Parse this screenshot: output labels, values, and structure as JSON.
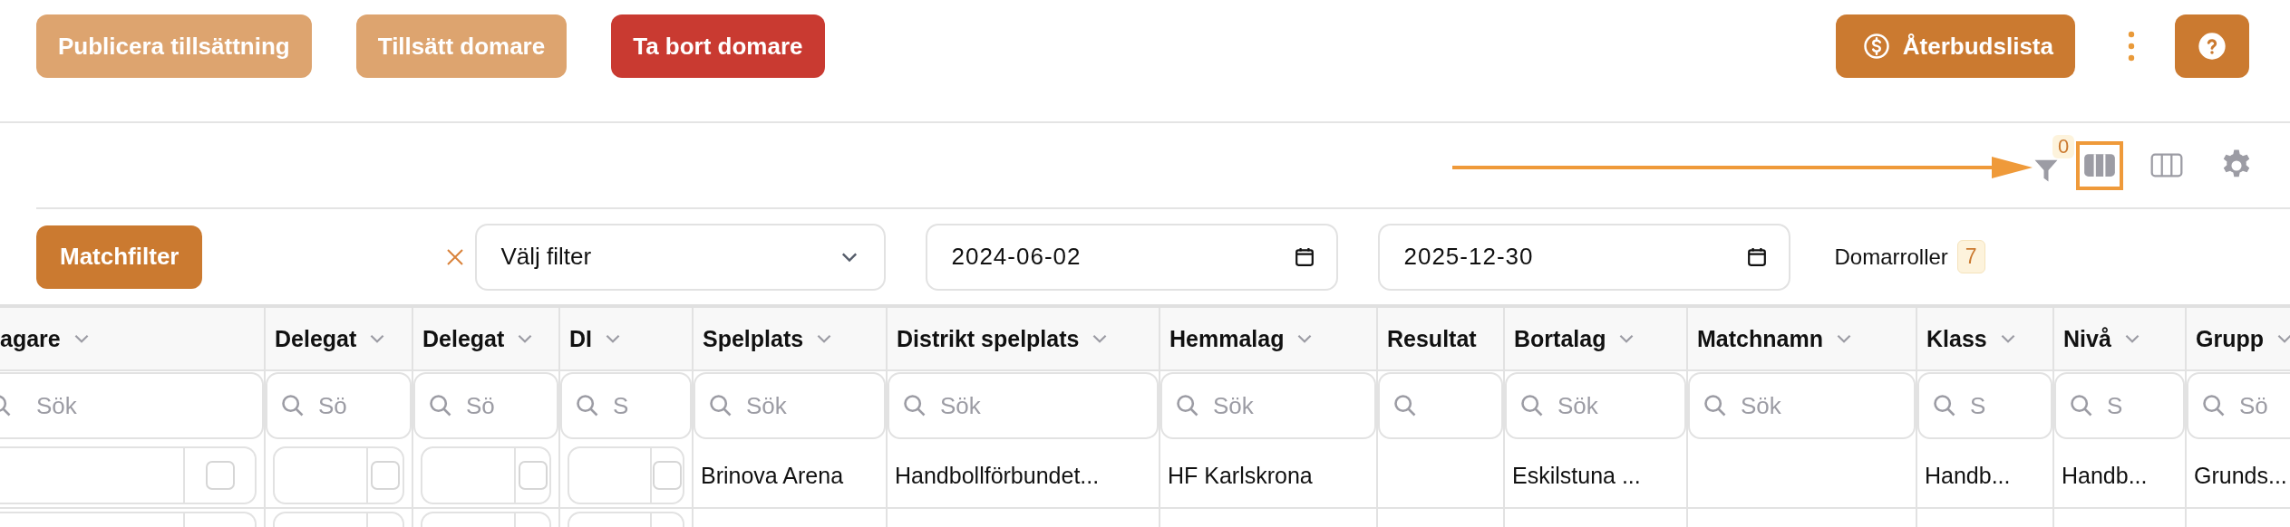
{
  "actions": {
    "buttons": [
      {
        "label": "Publicera tillsättning",
        "kind": "light"
      },
      {
        "label": "Tillsätt domare",
        "kind": "light"
      },
      {
        "label": "Ta bort domare",
        "kind": "danger"
      }
    ],
    "refund_button": {
      "label": "Återbudslista"
    }
  },
  "view_bar": {
    "filter_count": "0",
    "views": [
      {
        "selected": true
      },
      {
        "selected": false
      }
    ]
  },
  "filters": {
    "match_filter_button": "Matchfilter",
    "select": {
      "placeholder": "Välj filter"
    },
    "date_from": "2024-06-02",
    "date_to": "2025-12-30",
    "roles": {
      "label": "Domarroller",
      "count": "7"
    }
  },
  "table": {
    "columns": [
      {
        "title": "agare",
        "menu": true,
        "placeholder": "Sök",
        "kind": "check"
      },
      {
        "title": "Delegat",
        "menu": true,
        "placeholder": "Sö",
        "kind": "check"
      },
      {
        "title": "Delegat",
        "menu": true,
        "placeholder": "Sö",
        "kind": "check"
      },
      {
        "title": "DI",
        "menu": true,
        "placeholder": "S",
        "kind": "check"
      },
      {
        "title": "Spelplats",
        "menu": true,
        "placeholder": "Sök",
        "kind": "text"
      },
      {
        "title": "Distrikt spelplats",
        "menu": true,
        "placeholder": "Sök",
        "kind": "text"
      },
      {
        "title": "Hemmalag",
        "menu": true,
        "placeholder": "Sök",
        "kind": "text"
      },
      {
        "title": "Resultat",
        "menu": false,
        "kind": "text"
      },
      {
        "title": "Bortalag",
        "menu": true,
        "placeholder": "Sök",
        "kind": "text"
      },
      {
        "title": "Matchnamn",
        "menu": true,
        "placeholder": "Sök",
        "kind": "text"
      },
      {
        "title": "Klass",
        "menu": true,
        "placeholder": "S",
        "kind": "text"
      },
      {
        "title": "Nivå",
        "menu": true,
        "placeholder": "S",
        "kind": "text"
      },
      {
        "title": "Grupp",
        "menu": true,
        "placeholder": "Sö",
        "kind": "text"
      }
    ],
    "rows": [
      {
        "cells": [
          {
            "checked": false
          },
          {
            "checked": false
          },
          {
            "checked": false
          },
          {
            "checked": false
          },
          {
            "text": "Brinova Arena"
          },
          {
            "text": "Handbollförbundet..."
          },
          {
            "text": "HF Karlskrona"
          },
          {},
          {
            "text": "Eskilstuna ..."
          },
          {},
          {
            "text": "Handb..."
          },
          {
            "text": "Handb..."
          },
          {
            "text": "Grunds..."
          }
        ]
      }
    ]
  }
}
